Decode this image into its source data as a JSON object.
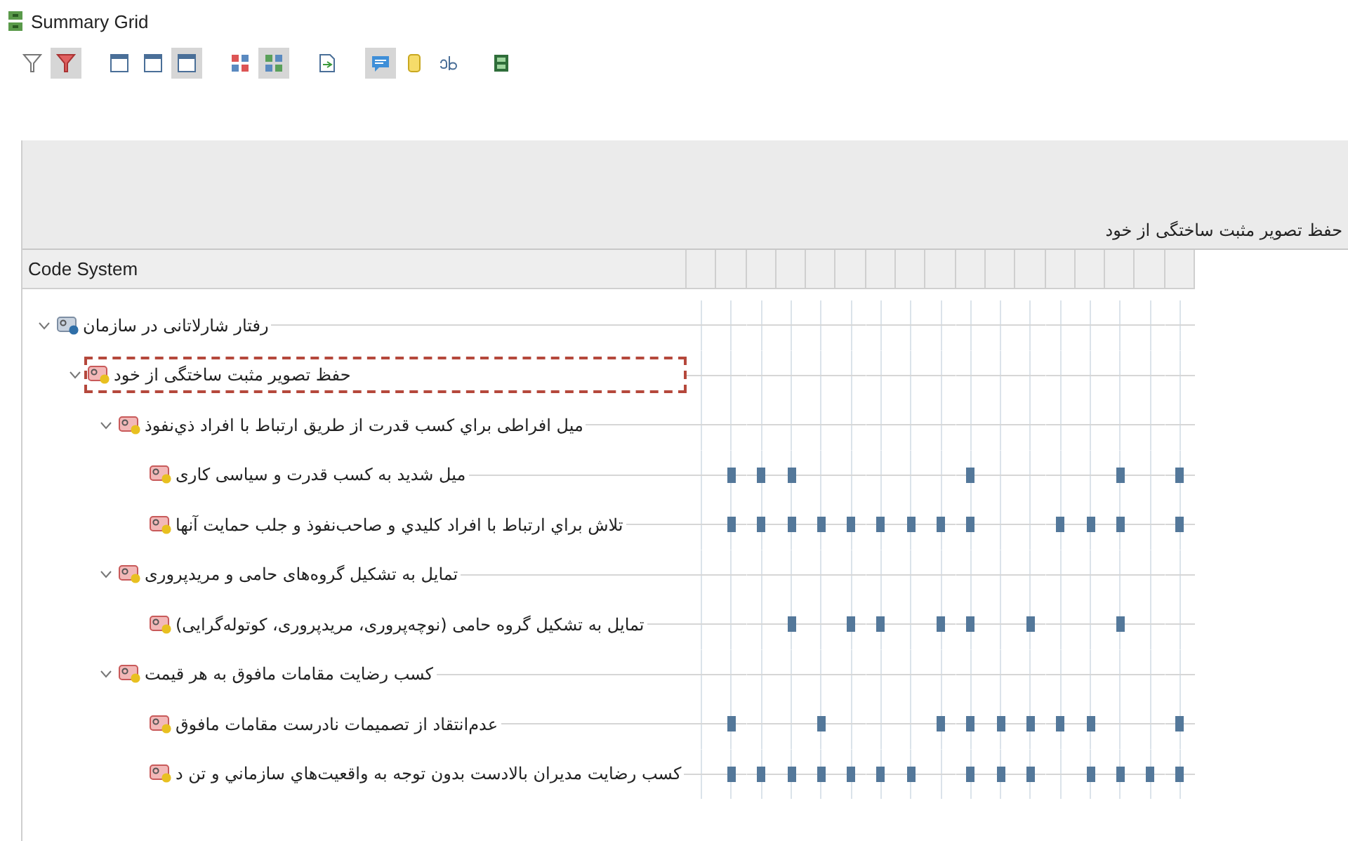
{
  "window": {
    "title": "Summary Grid"
  },
  "toolbar": [
    {
      "kind": "funnel",
      "selected": false
    },
    {
      "kind": "funnel-red",
      "selected": true
    },
    {
      "kind": "column",
      "selected": false
    },
    {
      "kind": "column",
      "selected": false
    },
    {
      "kind": "column",
      "selected": true
    },
    {
      "kind": "grid-red",
      "selected": false
    },
    {
      "kind": "grid-green",
      "selected": true
    },
    {
      "kind": "document",
      "selected": false
    },
    {
      "kind": "bubble",
      "selected": true
    },
    {
      "kind": "tag",
      "selected": false
    },
    {
      "kind": "letters",
      "selected": false
    },
    {
      "kind": "summary",
      "selected": false
    }
  ],
  "info_bar": {
    "text": "حفظ تصویر مثبت ساختگی از خود"
  },
  "table": {
    "tree_header": "Code System",
    "tree": [
      {
        "label": "رفتار شارلاتانی در سازمان",
        "color": "#2f6fa8",
        "expanded": true,
        "selected": false,
        "children": [
          {
            "label": "حفظ تصویر مثبت ساختگی از خود",
            "color": "#e8c020",
            "expanded": true,
            "selected": true,
            "children": [
              {
                "label": "میل افراطی براي کسب قدرت از طريق ارتباط با افراد ذي‌نفوذ",
                "color": "#e8c020",
                "expanded": true,
                "selected": false,
                "children": [
                  {
                    "label": "میل شدید به کسب قدرت و سیاسی کاری",
                    "color": "#e8c020",
                    "selected": false,
                    "cells": [
                      false,
                      true,
                      true,
                      true,
                      false,
                      false,
                      false,
                      false,
                      false,
                      true,
                      false,
                      false,
                      false,
                      false,
                      true,
                      false,
                      true
                    ]
                  },
                  {
                    "label": "تلاش براي ارتباط با افراد کليدي و صاحب‌نفوذ و جلب حمايت آنها",
                    "color": "#e8c020",
                    "selected": false,
                    "cells": [
                      false,
                      true,
                      true,
                      true,
                      true,
                      true,
                      true,
                      true,
                      true,
                      true,
                      false,
                      false,
                      true,
                      true,
                      true,
                      false,
                      true
                    ]
                  }
                ]
              },
              {
                "label": "تمایل به تشکیل گروه‌های حامی و مریدپروری",
                "color": "#e8c020",
                "expanded": true,
                "selected": false,
                "children": [
                  {
                    "label": "تمایل به تشکیل گروه حامی (نوچه‌پروری، مریدپروری، کوتوله‌گرایی)",
                    "color": "#e8c020",
                    "selected": false,
                    "cells": [
                      false,
                      false,
                      false,
                      true,
                      false,
                      true,
                      true,
                      false,
                      true,
                      true,
                      false,
                      true,
                      false,
                      false,
                      true,
                      false,
                      false
                    ]
                  }
                ]
              },
              {
                "label": "کسب رضایت مقامات مافوق به هر قیمت",
                "color": "#e8c020",
                "expanded": true,
                "selected": false,
                "children": [
                  {
                    "label": "عدم‌انتقاد از تصمیمات نادرست مقامات مافوق",
                    "color": "#e8c020",
                    "selected": false,
                    "cells": [
                      false,
                      true,
                      false,
                      false,
                      true,
                      false,
                      false,
                      false,
                      true,
                      true,
                      true,
                      true,
                      true,
                      true,
                      false,
                      false,
                      true
                    ]
                  },
                  {
                    "label": "کسب رضایت مدیران بالادست بدون توجه به واقعیت‌هاي سازماني و تن د",
                    "color": "#e8c020",
                    "selected": false,
                    "cells": [
                      false,
                      true,
                      true,
                      true,
                      true,
                      true,
                      true,
                      true,
                      false,
                      true,
                      true,
                      true,
                      false,
                      true,
                      true,
                      true,
                      true
                    ]
                  }
                ]
              }
            ]
          }
        ]
      }
    ]
  }
}
